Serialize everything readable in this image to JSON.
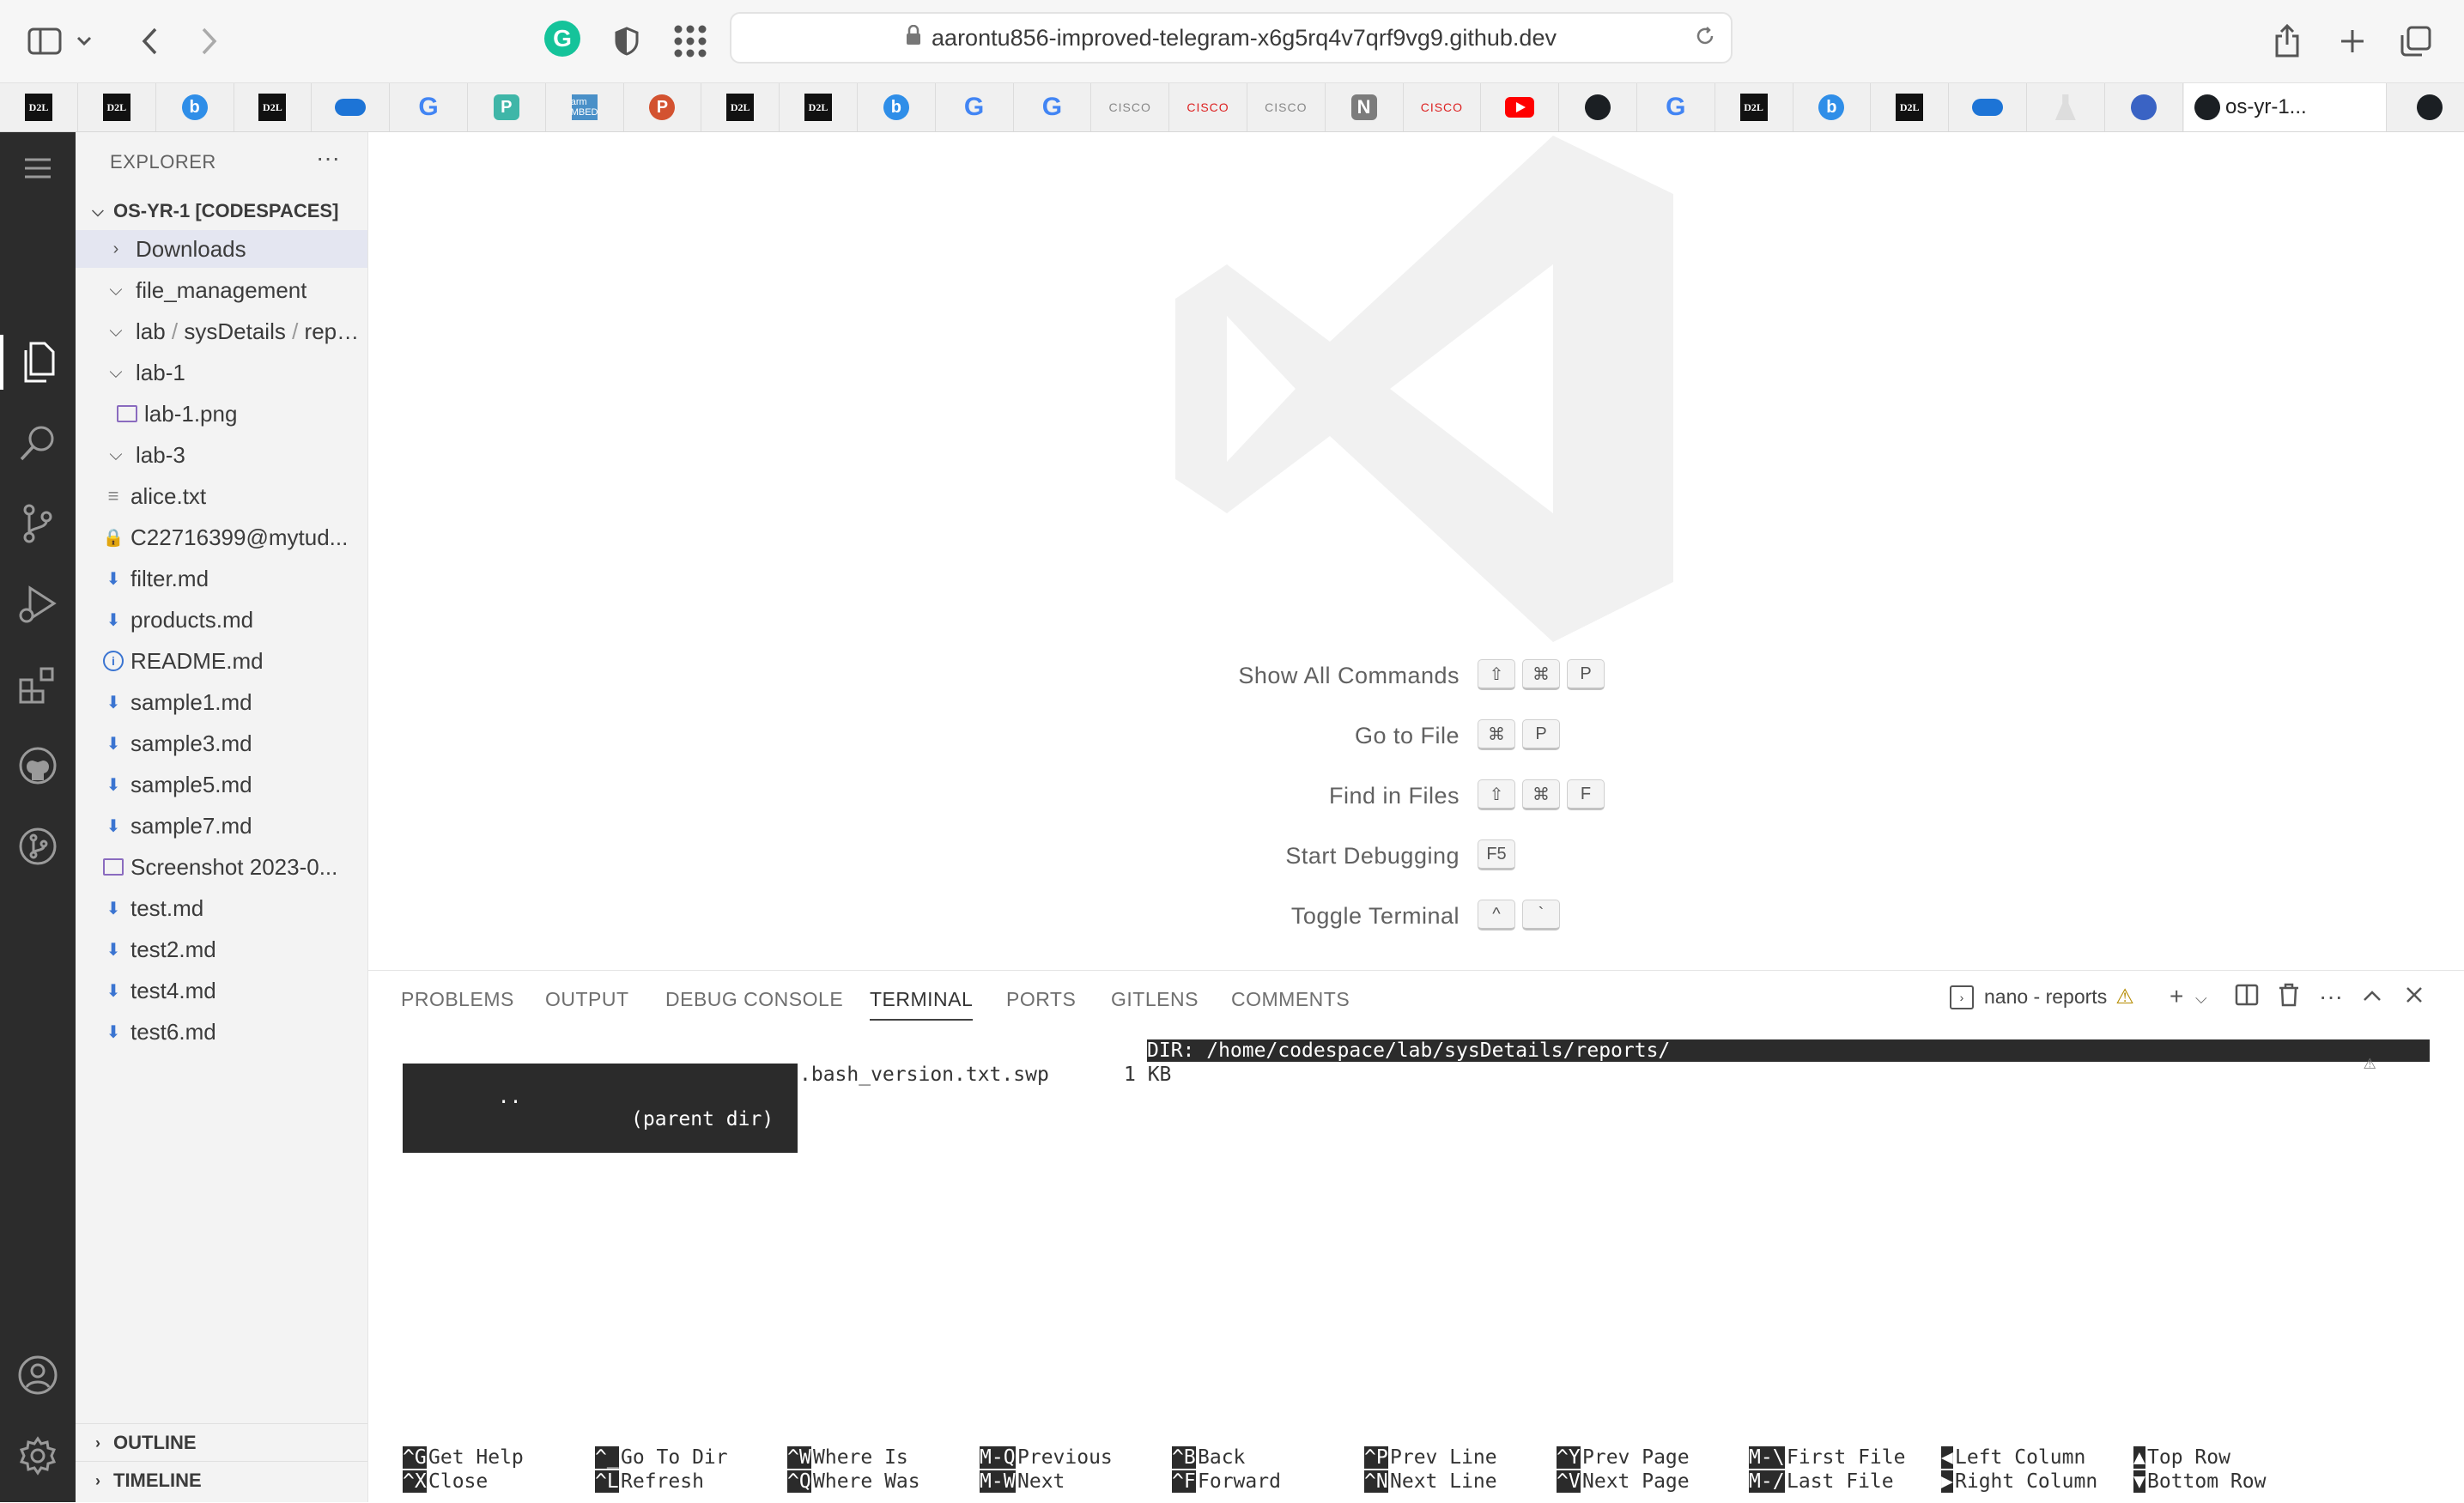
{
  "browser": {
    "url": "aarontu856-improved-telegram-x6g5rq4v7qrf9vg9.github.dev",
    "active_tab_title": "os-yr-1...",
    "favorites": [
      {
        "kind": "d2l",
        "label": "D2L"
      },
      {
        "kind": "d2l",
        "label": "D2L"
      },
      {
        "kind": "bing",
        "label": "b"
      },
      {
        "kind": "d2l",
        "label": "D2L"
      },
      {
        "kind": "cloud",
        "label": ""
      },
      {
        "kind": "google",
        "label": "G"
      },
      {
        "kind": "pp",
        "label": "P"
      },
      {
        "kind": "arm",
        "label": "arm MBED"
      },
      {
        "kind": "ppt",
        "label": "P"
      },
      {
        "kind": "d2l",
        "label": "D2L"
      },
      {
        "kind": "d2l",
        "label": "D2L"
      },
      {
        "kind": "bing",
        "label": "b"
      },
      {
        "kind": "google",
        "label": "G"
      },
      {
        "kind": "google",
        "label": "G"
      },
      {
        "kind": "cisco",
        "label": "CISCO"
      },
      {
        "kind": "cisco-red",
        "label": "CISCO"
      },
      {
        "kind": "cisco",
        "label": "CISCO"
      },
      {
        "kind": "notion",
        "label": "N"
      },
      {
        "kind": "cisco-red",
        "label": "CISCO"
      },
      {
        "kind": "youtube",
        "label": ""
      },
      {
        "kind": "github",
        "label": ""
      },
      {
        "kind": "google",
        "label": "G"
      },
      {
        "kind": "d2l",
        "label": "D2L"
      },
      {
        "kind": "bing",
        "label": "b"
      },
      {
        "kind": "d2l",
        "label": "D2L"
      },
      {
        "kind": "cloud",
        "label": ""
      },
      {
        "kind": "flask",
        "label": ""
      },
      {
        "kind": "globe",
        "label": ""
      }
    ]
  },
  "explorer": {
    "title": "EXPLORER",
    "more": "···",
    "root": "OS-YR-1 [CODESPACES]",
    "items": [
      {
        "label": "Downloads",
        "type": "folder-collapsed"
      },
      {
        "label": "file_management",
        "type": "folder-expanded"
      },
      {
        "label": "lab",
        "type": "folder-expanded",
        "path": [
          "lab",
          "sysDetails",
          "repo..."
        ]
      },
      {
        "label": "lab-1",
        "type": "folder-expanded"
      },
      {
        "label": "lab-1.png",
        "type": "image"
      },
      {
        "label": "lab-3",
        "type": "folder-expanded"
      },
      {
        "label": "alice.txt",
        "type": "text"
      },
      {
        "label": "C22716399@mytud...",
        "type": "lock"
      },
      {
        "label": "filter.md",
        "type": "md"
      },
      {
        "label": "products.md",
        "type": "md"
      },
      {
        "label": "README.md",
        "type": "info"
      },
      {
        "label": "sample1.md",
        "type": "md"
      },
      {
        "label": "sample3.md",
        "type": "md"
      },
      {
        "label": "sample5.md",
        "type": "md"
      },
      {
        "label": "sample7.md",
        "type": "md"
      },
      {
        "label": "Screenshot 2023-0...",
        "type": "image"
      },
      {
        "label": "test.md",
        "type": "md"
      },
      {
        "label": "test2.md",
        "type": "md"
      },
      {
        "label": "test4.md",
        "type": "md"
      },
      {
        "label": "test6.md",
        "type": "md"
      }
    ],
    "outline": "OUTLINE",
    "timeline": "TIMELINE"
  },
  "welcome": {
    "shortcuts": [
      {
        "label": "Show All Commands",
        "keys": [
          "⇧",
          "⌘",
          "P"
        ]
      },
      {
        "label": "Go to File",
        "keys": [
          "⌘",
          "P"
        ]
      },
      {
        "label": "Find in Files",
        "keys": [
          "⇧",
          "⌘",
          "F"
        ]
      },
      {
        "label": "Start Debugging",
        "keys": [
          "F5"
        ]
      },
      {
        "label": "Toggle Terminal",
        "keys": [
          "^",
          "`"
        ]
      }
    ]
  },
  "panel": {
    "tabs": [
      "PROBLEMS",
      "OUTPUT",
      "DEBUG CONSOLE",
      "TERMINAL",
      "PORTS",
      "GITLENS",
      "COMMENTS"
    ],
    "active_tab": "TERMINAL",
    "terminal_name": "nano - reports",
    "warning": "⚠"
  },
  "terminal": {
    "dir_header": "DIR: /home/codespace/lab/sysDetails/reports/",
    "row1_parent_name": "..",
    "row1_parent_label": "(parent dir)",
    "row1_file": ".bash_version.txt.swp",
    "row1_size": "1 KB",
    "shortcuts": [
      {
        "k1": "^G",
        "l1": "Get Help",
        "k2": "^X",
        "l2": "Close"
      },
      {
        "k1": "^_",
        "l1": "Go To Dir",
        "k2": "^L",
        "l2": "Refresh"
      },
      {
        "k1": "^W",
        "l1": "Where Is",
        "k2": "^Q",
        "l2": "Where Was"
      },
      {
        "k1": "M-Q",
        "l1": "Previous",
        "k2": "M-W",
        "l2": "Next"
      },
      {
        "k1": "^B",
        "l1": "Back",
        "k2": "^F",
        "l2": "Forward"
      },
      {
        "k1": "^P",
        "l1": "Prev Line",
        "k2": "^N",
        "l2": "Next Line"
      },
      {
        "k1": "^Y",
        "l1": "Prev Page",
        "k2": "^V",
        "l2": "Next Page"
      },
      {
        "k1": "M-\\",
        "l1": "First File",
        "k2": "M-/",
        "l2": "Last File"
      },
      {
        "k1": "◀",
        "l1": "Left Column",
        "k2": "▶",
        "l2": "Right Column"
      },
      {
        "k1": "▲",
        "l1": "Top Row",
        "k2": "▼",
        "l2": "Bottom Row"
      }
    ]
  },
  "colors": {
    "activity_bar": "#2c2c2c",
    "sidebar": "#f3f3f3",
    "selection": "#e4e6f1",
    "terminal_inverse": "#2b2b2b"
  }
}
